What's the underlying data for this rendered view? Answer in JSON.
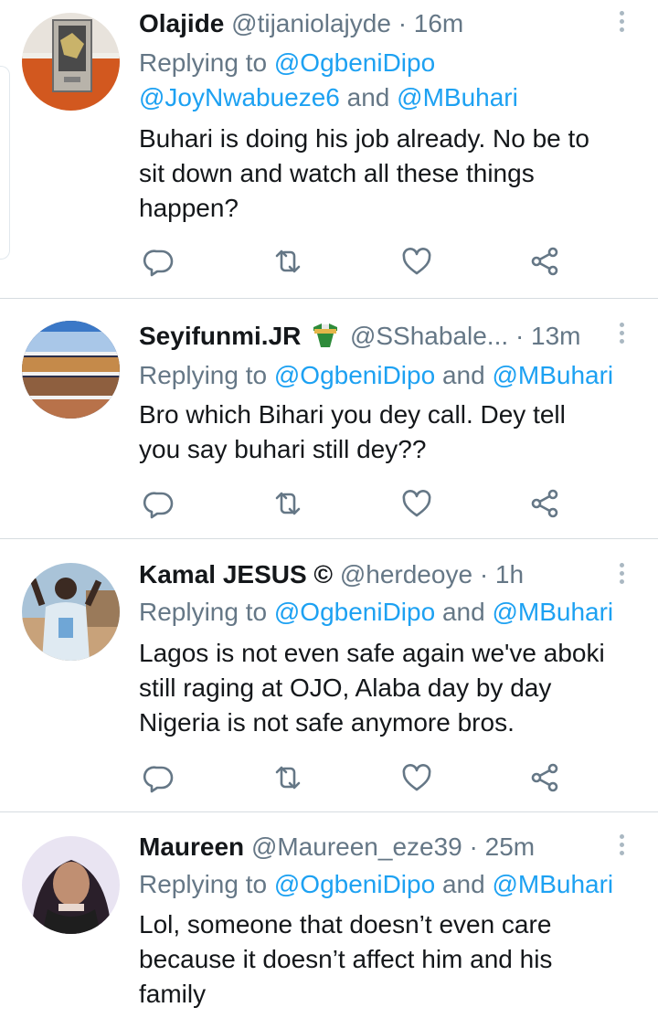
{
  "tweets": [
    {
      "name": "Olajide",
      "handle": "@tijaniolajyde",
      "time": "· 16m",
      "reply_prefix": "Replying to",
      "reply_line1": "@OgbeniDipo",
      "reply_line2_a": "@JoyNwabueze6",
      "reply_line2_and": "and",
      "reply_line2_b": "@MBuhari",
      "text_lines": [
        "Buhari is doing his job already. No be to",
        "sit down and watch all these things",
        "happen?"
      ]
    },
    {
      "name": "Seyifunmi.JR",
      "handle": "@SShabale...",
      "time": "· 13m",
      "reply_prefix": "Replying to",
      "reply_a": "@OgbeniDipo",
      "reply_and": "and",
      "reply_b": "@MBuhari",
      "text_lines": [
        "Bro which Bihari you dey call. Dey tell",
        "you say buhari still dey??"
      ]
    },
    {
      "name": "Kamal JESUS ©",
      "handle": "@herdeoye",
      "time": "· 1h",
      "reply_prefix": "Replying to",
      "reply_a": "@OgbeniDipo",
      "reply_and": "and",
      "reply_b": "@MBuhari",
      "text_lines": [
        "Lagos is not even safe again we've aboki",
        "still raging at OJO, Alaba day by day",
        "Nigeria is not safe anymore bros."
      ]
    },
    {
      "name": "Maureen",
      "handle": "@Maureen_eze39",
      "time": "· 25m",
      "reply_prefix": "Replying to",
      "reply_a": "@OgbeniDipo",
      "reply_and": "and",
      "reply_b": "@MBuhari",
      "text_lines": [
        "Lol, someone that doesn’t even care",
        "because it doesn’t affect him and his",
        "family"
      ]
    }
  ],
  "icons": {
    "reply": "reply-icon",
    "retweet": "retweet-icon",
    "like": "heart-icon",
    "share": "share-icon",
    "more": "more-vertical-icon"
  },
  "colors": {
    "link": "#1da1f2",
    "secondary_text": "#657786",
    "action_icon": "#657786",
    "divider": "#d6dce0"
  }
}
